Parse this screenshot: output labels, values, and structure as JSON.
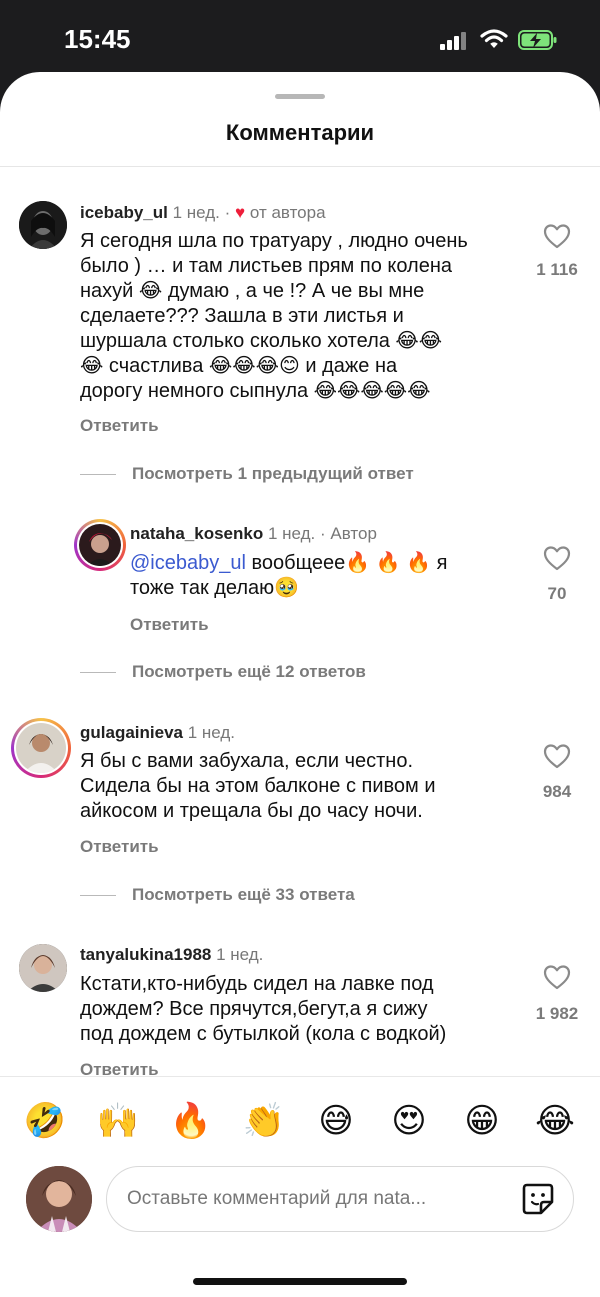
{
  "status_bar": {
    "time": "15:45"
  },
  "sheet": {
    "title": "Комментарии"
  },
  "comments": [
    {
      "username": "icebaby_ul",
      "time": "1 нед.",
      "separator": "·",
      "badge": "от автора",
      "lines": [
        "Я сегодня шла по тратуару , людно очень",
        "было ) … и там листьев прям по колена",
        "нахуй 😂 думаю , а че !? А че вы мне",
        "сделаете??? Зашла в эти листья и",
        "шуршала столько сколько хотела 😂😂",
        "😂 счастлива 😂😂😂😊 и даже на",
        "дорогу немного сыпнула 😂😂😂😂😂"
      ],
      "reply_label": "Ответить",
      "likes": "1 116",
      "view_replies": "Посмотреть 1 предыдущий ответ"
    },
    {
      "username": "nataha_kosenko",
      "time": "1 нед.",
      "separator": "·",
      "badge": "Автор",
      "mention": "@icebaby_ul",
      "line1_rest": " вообщеее🔥 🔥 🔥 я",
      "line2": "тоже так делаю🥹",
      "reply_label": "Ответить",
      "likes": "70",
      "view_replies": "Посмотреть ещё 12 ответов"
    },
    {
      "username": "gulagainieva",
      "time": "1 нед.",
      "lines": [
        "Я бы с вами забухала, если честно.",
        "Сидела бы на этом балконе с пивом и",
        "айкосом и трещала бы до часу ночи."
      ],
      "reply_label": "Ответить",
      "likes": "984",
      "view_replies": "Посмотреть ещё 33 ответа"
    },
    {
      "username": "tanyalukina1988",
      "time": "1 нед.",
      "lines": [
        "Кстати,кто-нибудь сидел на лавке под",
        "дождем? Все прячутся,бегут,а я сижу",
        "под дождем с бутылкой (кола с водкой)"
      ],
      "reply_label": "Ответить",
      "likes": "1 982"
    }
  ],
  "emoji_bar": [
    "🤣",
    "🙌",
    "🔥",
    "👏",
    "😅",
    "😍",
    "😁",
    "😂"
  ],
  "input": {
    "placeholder": "Оставьте комментарий для nata..."
  },
  "icons": [
    "signal-icon",
    "wifi-icon",
    "battery-charging-icon",
    "heart-icon",
    "like-icon",
    "sticker-icon"
  ],
  "colors": {
    "status_bg": "#1c1c1e",
    "mention": "#3b5ad0",
    "author_heart": "#ee1e3a",
    "secondary_text": "#7a7a7a"
  }
}
